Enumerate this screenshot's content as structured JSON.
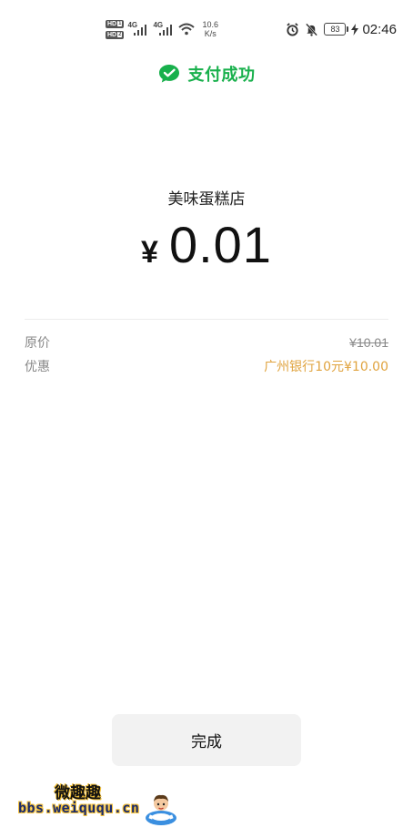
{
  "status_bar": {
    "hd_badge_1": "HD",
    "hd_badge_2": "HD",
    "hd_sub_1": "1",
    "hd_sub_2": "2",
    "network_1": "4G",
    "network_2": "4G",
    "speed_value": "10.6",
    "speed_unit": "K/s",
    "battery_level": "83",
    "time": "02:46"
  },
  "header": {
    "success_title": "支付成功",
    "accent_color": "#18b04c"
  },
  "payment": {
    "merchant_name": "美味蛋糕店",
    "currency_symbol": "¥",
    "amount": "0.01"
  },
  "details": {
    "original_price_label": "原价",
    "original_price_value": "¥10.01",
    "discount_label": "优惠",
    "discount_value": "广州银行10元¥10.00",
    "discount_color": "#e0a33e"
  },
  "actions": {
    "done_label": "完成"
  },
  "watermark": {
    "title": "微趣趣",
    "url": "bbs.weiququ.cn"
  }
}
